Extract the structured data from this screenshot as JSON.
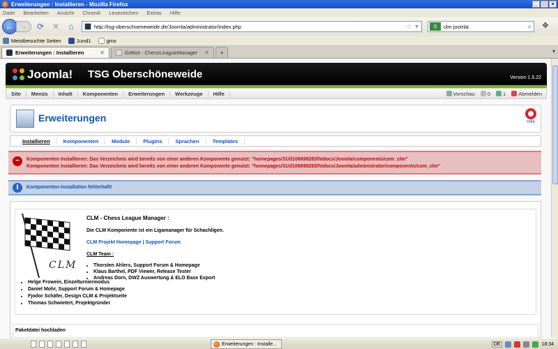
{
  "window": {
    "title": "Erweiterungen : Installieren - Mozilla Firefox",
    "controls": [
      "_",
      "□",
      "×"
    ]
  },
  "menubar": [
    "Datei",
    "Bearbeiten",
    "Ansicht",
    "Chronik",
    "Lesezeichen",
    "Extras",
    "Hilfe"
  ],
  "navbar": {
    "url": "http://tsg-oberschoeneweide.de/Joomla/administrator/index.php",
    "search_value": "clm joomla"
  },
  "bookmarks": [
    "Meistbesuchte Seiten",
    "1und1",
    "gmx"
  ],
  "tabs": [
    {
      "label": "Erweiterungen : Installieren",
      "active": true
    },
    {
      "label": "Gelöst - ChessLeagueManager",
      "active": false
    }
  ],
  "joomla": {
    "logo_text": "Joomla!",
    "site_name": "TSG Oberschöneweide",
    "version": "Version 1.5.22",
    "menu": [
      "Site",
      "Menüs",
      "Inhalt",
      "Komponenten",
      "Erweiterungen",
      "Werkzeuge",
      "Hilfe"
    ],
    "status": {
      "preview": "Vorschau",
      "messages": "0",
      "users": "1",
      "logout": "Abmelden"
    },
    "page_title": "Erweiterungen",
    "help_label": "Hilfe",
    "submenu": [
      "Installieren",
      "Komponenten",
      "Module",
      "Plugins",
      "Sprachen",
      "Templates"
    ],
    "errors": [
      "Komponenten Installieren: Das Verzeichnis wird bereits von einer anderen Komponente genutzt: \"homepages/31/d106698283/htdocs/Joomla/components/com_clm\"",
      "Komponenten Installieren: Das Verzeichnis wird bereits von einer anderen Komponente genutzt: \"homepages/31/d106698283/htdocs/Joomla/administrator/components/com_clm\""
    ],
    "info": "Komponenten-Installation fehlerhaft!",
    "clm": {
      "logo_text": "CLM",
      "title": "CLM - Chess League Manager :",
      "description": "Die CLM Komponente ist ein Ligamanager für Schachligen.",
      "link_homepage": "CLM Projekt Homepage",
      "link_separator": " | ",
      "link_forum": "Support Forum",
      "team_heading": "CLM Team :",
      "team_inner": [
        "Thorsten Ahlers, Support Forum & Homepage",
        "Klaus Barthel, PDF Viewer, Release Tester",
        "Andreas Dorn, DWZ Auswertung & ELO Base Export"
      ],
      "team_outer": [
        "Helge Frowein, Einzelturniermodus",
        "Daniel Mohr, Support Forum & Homepage",
        "Fjodor Schäfer, Design CLM & Projektseite",
        "Thomas Schwietert, Projektgründer"
      ]
    },
    "upload_heading": "Paketdatei hochladen"
  },
  "taskbar": {
    "task_label": "Erweiterungen : Installe...",
    "lang": "DE",
    "clock": "18:34"
  }
}
